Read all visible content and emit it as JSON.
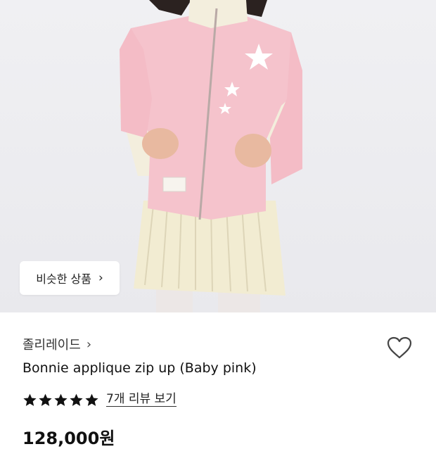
{
  "product": {
    "image_alt_colors": {
      "jacket": "#f5c3cc",
      "trim": "#f3eedd",
      "skirt": "#f2ecd2"
    },
    "similar_button": {
      "label": "비슷한 상품",
      "chevron_icon": "chevron-right-icon"
    },
    "brand": {
      "name": "졸리레이드",
      "chevron_icon": "chevron-right-icon"
    },
    "wishlist_icon": "heart-outline-icon",
    "name": "Bonnie applique zip up (Baby pink)",
    "rating": {
      "stars": 5,
      "max": 5
    },
    "review_link": "7개 리뷰 보기",
    "price": "128,000원"
  }
}
